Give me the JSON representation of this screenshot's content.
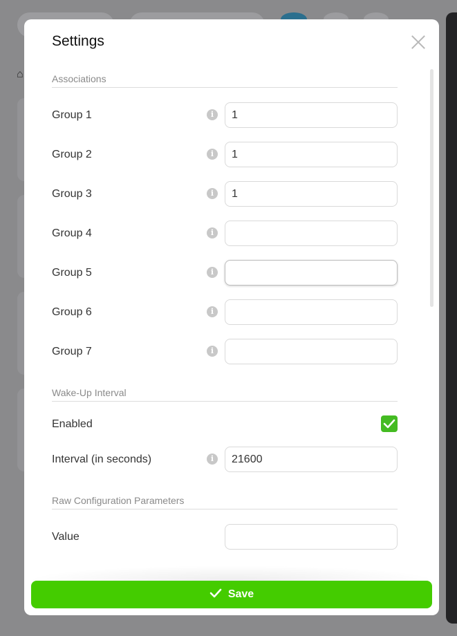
{
  "modal": {
    "title": "Settings",
    "close_icon": "close-icon"
  },
  "associations": {
    "section_title": "Associations",
    "groups": [
      {
        "label": "Group 1",
        "value": "1"
      },
      {
        "label": "Group 2",
        "value": "1"
      },
      {
        "label": "Group 3",
        "value": "1"
      },
      {
        "label": "Group 4",
        "value": ""
      },
      {
        "label": "Group 5",
        "value": ""
      },
      {
        "label": "Group 6",
        "value": ""
      },
      {
        "label": "Group 7",
        "value": ""
      }
    ]
  },
  "wake_up": {
    "section_title": "Wake-Up Interval",
    "enabled_label": "Enabled",
    "enabled": true,
    "interval_label": "Interval (in seconds)",
    "interval_value": "21600"
  },
  "raw_config": {
    "section_title": "Raw Configuration Parameters",
    "value_label": "Value",
    "value": ""
  },
  "footer": {
    "save_label": "Save"
  },
  "colors": {
    "accent": "#44cc00",
    "checkbox": "#44bb22"
  }
}
